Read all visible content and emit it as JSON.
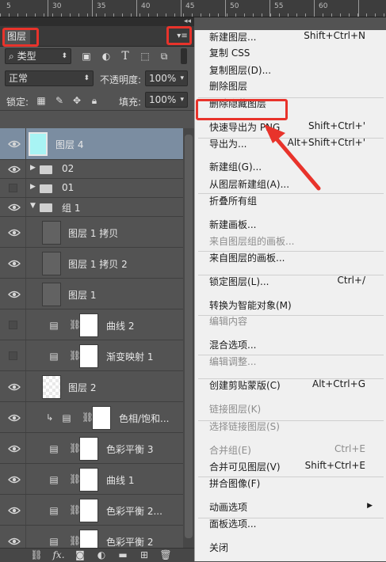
{
  "ruler": {
    "labels": [
      "5",
      "30",
      "35",
      "40",
      "45",
      "50",
      "55",
      "60"
    ]
  },
  "panel": {
    "tab_label": "图层",
    "menu_glyph": "▾≡",
    "collapse_glyph": "◂◂",
    "filter": {
      "kind": "类型",
      "search_glyph": "⌕"
    },
    "blend": {
      "mode": "正常",
      "opacity_label": "不透明度:",
      "opacity_value": "100%"
    },
    "lock": {
      "label": "锁定:",
      "fill_label": "填充:",
      "fill_value": "100%"
    },
    "layers": [
      {
        "name": "图层 4",
        "type": "pixel-cyan",
        "visible": true,
        "selected": true
      },
      {
        "name": "02",
        "type": "group-collapsed",
        "visible": true
      },
      {
        "name": "01",
        "type": "group-collapsed",
        "visible": false
      },
      {
        "name": "组 1",
        "type": "group-expanded",
        "visible": true
      },
      {
        "name": "图层 1 拷贝",
        "type": "pixel",
        "visible": true
      },
      {
        "name": "图层 1 拷贝 2",
        "type": "pixel",
        "visible": true
      },
      {
        "name": "图层 1",
        "type": "pixel",
        "visible": true
      },
      {
        "name": "曲线 2",
        "type": "adjustment",
        "visible": false
      },
      {
        "name": "渐变映射 1",
        "type": "adjustment",
        "visible": false
      },
      {
        "name": "图层 2",
        "type": "transparent",
        "visible": true
      },
      {
        "name": "色相/饱和...",
        "type": "adjustment-clip",
        "visible": true
      },
      {
        "name": "色彩平衡 3",
        "type": "adjustment",
        "visible": true
      },
      {
        "name": "曲线 1",
        "type": "adjustment",
        "visible": true
      },
      {
        "name": "色彩平衡 2...",
        "type": "adjustment",
        "visible": true
      },
      {
        "name": "色彩平衡 2",
        "type": "adjustment",
        "visible": true
      }
    ]
  },
  "menu": {
    "items": [
      {
        "label": "新建图层...",
        "shortcut": "Shift+Ctrl+N",
        "enabled": true
      },
      {
        "label": "复制 CSS",
        "shortcut": "",
        "enabled": true
      },
      {
        "label": "复制图层(D)...",
        "shortcut": "",
        "enabled": true
      },
      {
        "label": "删除图层",
        "shortcut": "",
        "enabled": true
      },
      {
        "label": "删除隐藏图层",
        "shortcut": "",
        "enabled": true,
        "highlighted": true
      },
      {
        "label": "快速导出为 PNG",
        "shortcut": "Shift+Ctrl+'",
        "enabled": true
      },
      {
        "label": "导出为...",
        "shortcut": "Alt+Shift+Ctrl+'",
        "enabled": true
      },
      {
        "label": "新建组(G)...",
        "shortcut": "",
        "enabled": true
      },
      {
        "label": "从图层新建组(A)...",
        "shortcut": "",
        "enabled": true
      },
      {
        "label": "折叠所有组",
        "shortcut": "",
        "enabled": true
      },
      {
        "label": "新建画板...",
        "shortcut": "",
        "enabled": true
      },
      {
        "label": "来自图层组的画板...",
        "shortcut": "",
        "enabled": false
      },
      {
        "label": "来自图层的画板...",
        "shortcut": "",
        "enabled": true
      },
      {
        "label": "锁定图层(L)...",
        "shortcut": "Ctrl+/",
        "enabled": true
      },
      {
        "label": "转换为智能对象(M)",
        "shortcut": "",
        "enabled": true
      },
      {
        "label": "编辑内容",
        "shortcut": "",
        "enabled": false
      },
      {
        "label": "混合选项...",
        "shortcut": "",
        "enabled": true
      },
      {
        "label": "编辑调整...",
        "shortcut": "",
        "enabled": false
      },
      {
        "label": "创建剪贴蒙版(C)",
        "shortcut": "Alt+Ctrl+G",
        "enabled": true
      },
      {
        "label": "链接图层(K)",
        "shortcut": "",
        "enabled": false
      },
      {
        "label": "选择链接图层(S)",
        "shortcut": "",
        "enabled": false
      },
      {
        "label": "合并组(E)",
        "shortcut": "Ctrl+E",
        "enabled": false
      },
      {
        "label": "合并可见图层(V)",
        "shortcut": "Shift+Ctrl+E",
        "enabled": true
      },
      {
        "label": "拼合图像(F)",
        "shortcut": "",
        "enabled": true
      },
      {
        "label": "动画选项",
        "shortcut": "",
        "enabled": true,
        "submenu": true
      },
      {
        "label": "面板选项...",
        "shortcut": "",
        "enabled": true
      },
      {
        "label": "关闭",
        "shortcut": "",
        "enabled": true
      }
    ]
  },
  "colors": {
    "accent": "#e8332b",
    "selected_row": "#7b8da1",
    "cyan_thumb": "#a8f4f4"
  }
}
